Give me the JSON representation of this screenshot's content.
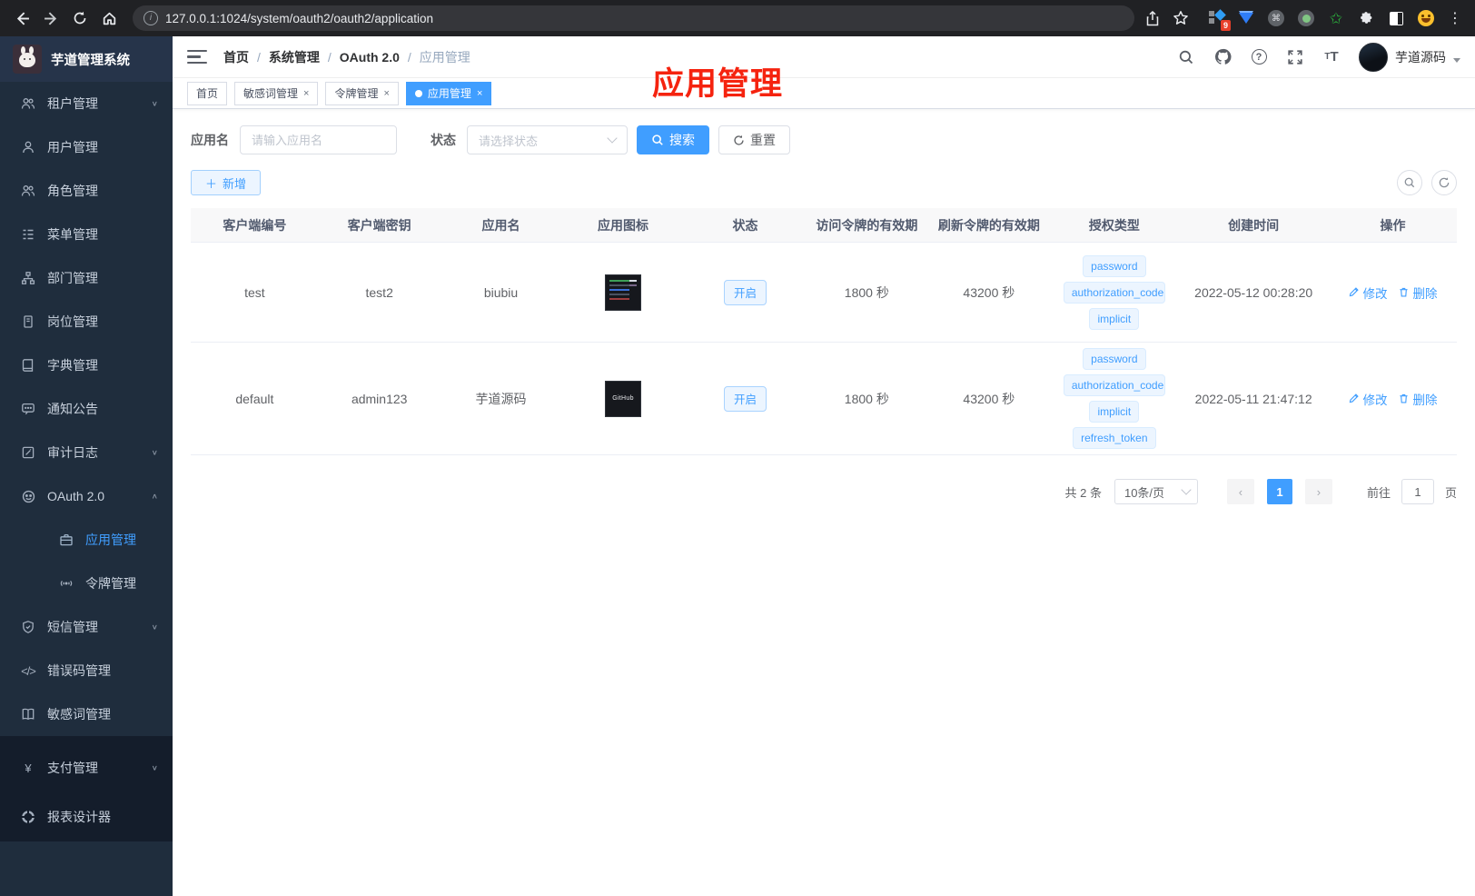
{
  "browser": {
    "url": "127.0.0.1:1024/system/oauth2/oauth2/application",
    "extension_badge": "9"
  },
  "sidebar": {
    "app_title": "芋道管理系统",
    "items": [
      {
        "label": "租户管理",
        "icon": "users-icon"
      },
      {
        "label": "用户管理",
        "icon": "user-icon"
      },
      {
        "label": "角色管理",
        "icon": "roles-icon"
      },
      {
        "label": "菜单管理",
        "icon": "menu-tree-icon"
      },
      {
        "label": "部门管理",
        "icon": "org-icon"
      },
      {
        "label": "岗位管理",
        "icon": "post-badge-icon"
      },
      {
        "label": "字典管理",
        "icon": "dictionary-icon"
      },
      {
        "label": "通知公告",
        "icon": "notice-icon"
      },
      {
        "label": "审计日志",
        "icon": "audit-log-icon"
      },
      {
        "label": "OAuth 2.0",
        "icon": "oauth-icon"
      },
      {
        "label": "应用管理",
        "icon": "application-icon"
      },
      {
        "label": "令牌管理",
        "icon": "token-icon"
      },
      {
        "label": "短信管理",
        "icon": "sms-shield-icon"
      },
      {
        "label": "错误码管理",
        "icon": "error-code-icon"
      },
      {
        "label": "敏感词管理",
        "icon": "sensitive-word-icon"
      },
      {
        "label": "支付管理",
        "icon": "pay-yen-icon"
      },
      {
        "label": "报表设计器",
        "icon": "report-designer-icon"
      }
    ]
  },
  "header": {
    "breadcrumb": [
      "首页",
      "系统管理",
      "OAuth 2.0",
      "应用管理"
    ],
    "username": "芋道源码"
  },
  "tabs": [
    {
      "label": "首页"
    },
    {
      "label": "敏感词管理"
    },
    {
      "label": "令牌管理"
    },
    {
      "label": "应用管理"
    }
  ],
  "annotation_title": "应用管理",
  "filters": {
    "name_label": "应用名",
    "name_placeholder": "请输入应用名",
    "status_label": "状态",
    "status_placeholder": "请选择状态",
    "search_label": "搜索",
    "reset_label": "重置"
  },
  "toolbar": {
    "add_label": "新增"
  },
  "table": {
    "headers": [
      "客户端编号",
      "客户端密钥",
      "应用名",
      "应用图标",
      "状态",
      "访问令牌的有效期",
      "刷新令牌的有效期",
      "授权类型",
      "创建时间",
      "操作"
    ],
    "rows": [
      {
        "client_id": "test",
        "client_secret": "test2",
        "app_name": "biubiu",
        "status": "开启",
        "access_token_validity": "1800 秒",
        "refresh_token_validity": "43200 秒",
        "grant_types": [
          "password",
          "authorization_code",
          "implicit"
        ],
        "create_time": "2022-05-12 00:28:20",
        "edit_label": "修改",
        "delete_label": "删除"
      },
      {
        "client_id": "default",
        "client_secret": "admin123",
        "app_name": "芋道源码",
        "icon_text": "GitHub",
        "status": "开启",
        "access_token_validity": "1800 秒",
        "refresh_token_validity": "43200 秒",
        "grant_types": [
          "password",
          "authorization_code",
          "implicit",
          "refresh_token"
        ],
        "create_time": "2022-05-11 21:47:12",
        "edit_label": "修改",
        "delete_label": "删除"
      }
    ]
  },
  "pagination": {
    "total": "共 2 条",
    "page_size": "10条/页",
    "current_page": "1",
    "goto_label": "前往",
    "goto_value": "1",
    "page_unit": "页"
  }
}
